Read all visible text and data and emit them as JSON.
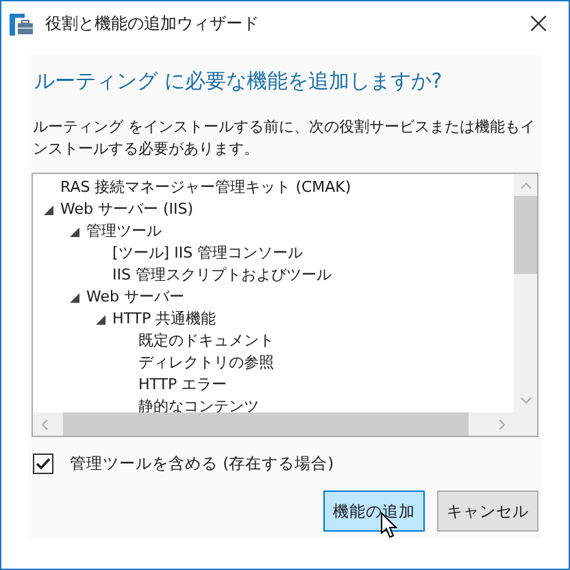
{
  "window": {
    "title": "役割と機能の追加ウィザード",
    "close": "×"
  },
  "heading": "ルーティング に必要な機能を追加しますか?",
  "description": "ルーティング をインストールする前に、次の役割サービスまたは機能もインストールする必要があります。",
  "tree": [
    {
      "label": "RAS 接続マネージャー管理キット (CMAK)"
    },
    {
      "label": "Web サーバー (IIS)",
      "expanded": true,
      "children": [
        {
          "label": "管理ツール",
          "expanded": true,
          "children": [
            {
              "label": "[ツール] IIS 管理コンソール"
            },
            {
              "label": "IIS 管理スクリプトおよびツール"
            }
          ]
        },
        {
          "label": "Web サーバー",
          "expanded": true,
          "children": [
            {
              "label": "HTTP 共通機能",
              "expanded": true,
              "children": [
                {
                  "label": "既定のドキュメント"
                },
                {
                  "label": "ディレクトリの参照"
                },
                {
                  "label": "HTTP エラー"
                },
                {
                  "label": "静的なコンテンツ"
                }
              ]
            }
          ]
        }
      ]
    }
  ],
  "checkbox": {
    "label": "管理ツールを含める (存在する場合)",
    "checked": true
  },
  "buttons": [
    {
      "label": "機能の追加",
      "selected": true
    },
    {
      "label": "キャンセル",
      "selected": false
    }
  ]
}
